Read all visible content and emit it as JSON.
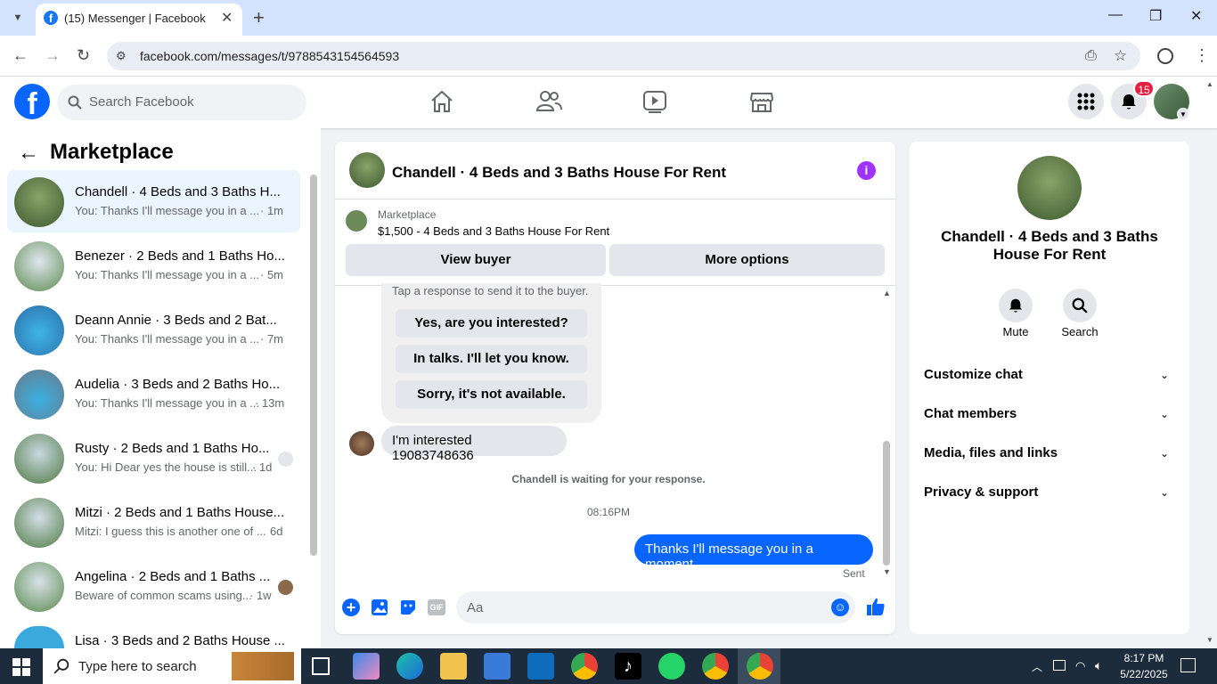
{
  "browser": {
    "tab_title": "(15) Messenger | Facebook",
    "url": "facebook.com/messages/t/9788543154564593"
  },
  "fb": {
    "search_placeholder": "Search Facebook",
    "notif_count": "15"
  },
  "left": {
    "title": "Marketplace",
    "items": [
      {
        "title": "Chandell · 4 Beds and 3 Baths H...",
        "sub": "You: Thanks I'll message you in a ...",
        "time": "· 1m"
      },
      {
        "title": "Benezer · 2 Beds and 1 Baths Ho...",
        "sub": "You: Thanks I'll message you in a ...",
        "time": "· 5m"
      },
      {
        "title": "Deann Annie · 3 Beds and 2 Bat...",
        "sub": "You: Thanks I'll message you in a ...",
        "time": "· 7m"
      },
      {
        "title": "Audelia · 3 Beds and 2 Baths Ho...",
        "sub": "You: Thanks I'll message you in a ...",
        "time": "· 13m"
      },
      {
        "title": "Rusty · 2 Beds and 1 Baths Ho...",
        "sub": "You: Hi Dear yes the house is still...",
        "time": "· 1d"
      },
      {
        "title": "Mitzi · 2 Beds and 1 Baths House...",
        "sub": "Mitzi: I guess this is another one of ...",
        "time": "6d"
      },
      {
        "title": "Angelina · 2 Beds and 1 Baths ...",
        "sub": "Beware of common scams using...",
        "time": "· 1w"
      },
      {
        "title": "Lisa · 3 Beds and 2 Baths House ...",
        "sub": "",
        "time": ""
      }
    ]
  },
  "chat": {
    "header": "Chandell · 4 Beds and 3 Baths House For Rent",
    "mp_label": "Marketplace",
    "mp_listing": "$1,500 - 4 Beds and 3 Baths House For Rent",
    "view_buyer": "View buyer",
    "more_options": "More options",
    "tap_hint": "Tap a response to send it to the buyer.",
    "quick": [
      "Yes, are you interested?",
      "In talks. I'll let you know.",
      "Sorry, it's not available."
    ],
    "incoming": "I'm interested 19083748636",
    "waiting": "Chandell is waiting for your response.",
    "time": "08:16PM",
    "outgoing": "Thanks I'll message you in a moment",
    "sent": "Sent",
    "input_placeholder": "Aa"
  },
  "right": {
    "name": "Chandell · 4 Beds and 3 Baths House For Rent",
    "mute": "Mute",
    "search": "Search",
    "rows": [
      "Customize chat",
      "Chat members",
      "Media, files and links",
      "Privacy & support"
    ]
  },
  "taskbar": {
    "search": "Type here to search",
    "time": "8:17 PM",
    "date": "5/22/2025"
  },
  "colors": {
    "accent": "#0866ff",
    "purple": "#a033ff"
  }
}
